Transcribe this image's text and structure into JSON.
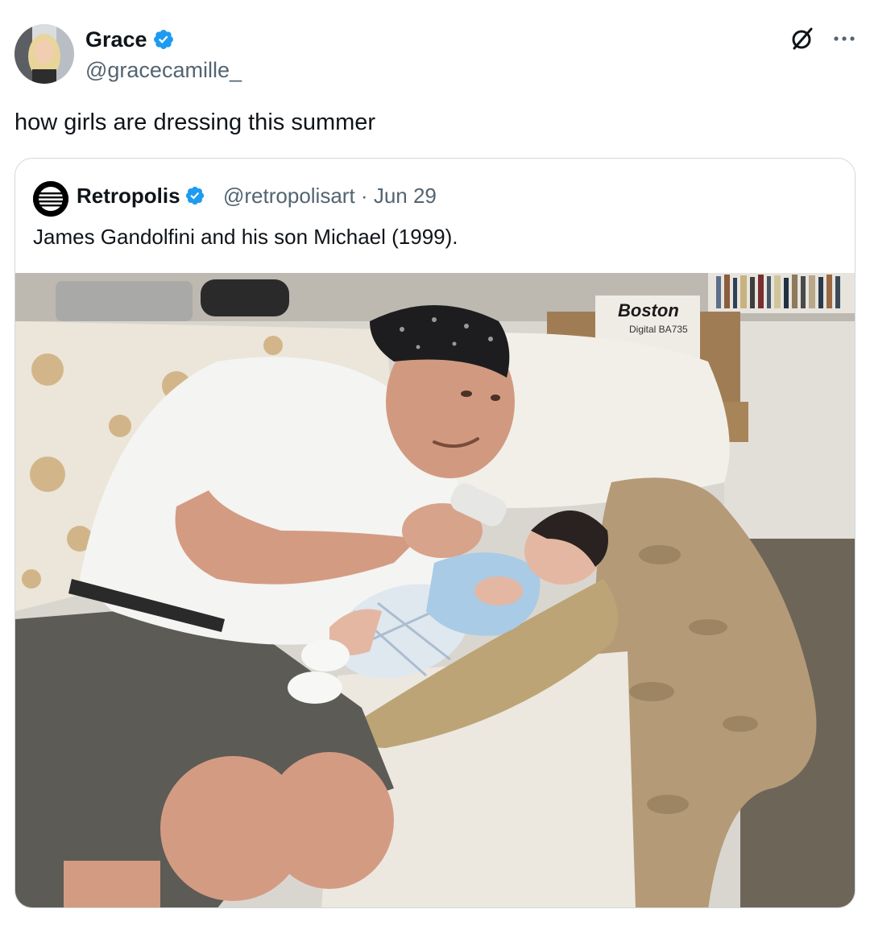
{
  "author": {
    "name": "Grace",
    "handle": "@gracecamille_",
    "verified": true,
    "avatar": "profile-photo"
  },
  "actions": {
    "grok_icon": "grok-icon",
    "more_icon": "more-icon"
  },
  "tweet": {
    "text": "how girls are dressing this summer"
  },
  "quoted": {
    "name": "Retropolis",
    "handle": "@retropolisart",
    "separator": "·",
    "date": "Jun 29",
    "verified": true,
    "text": "James Gandolfini and his son Michael (1999).",
    "media": {
      "box_brand": "Boston",
      "box_model": "Digital BA735"
    }
  },
  "colors": {
    "text_primary": "#0f1419",
    "text_secondary": "#536471",
    "verified_blue": "#1d9bf0",
    "card_border": "#cfd9de"
  }
}
